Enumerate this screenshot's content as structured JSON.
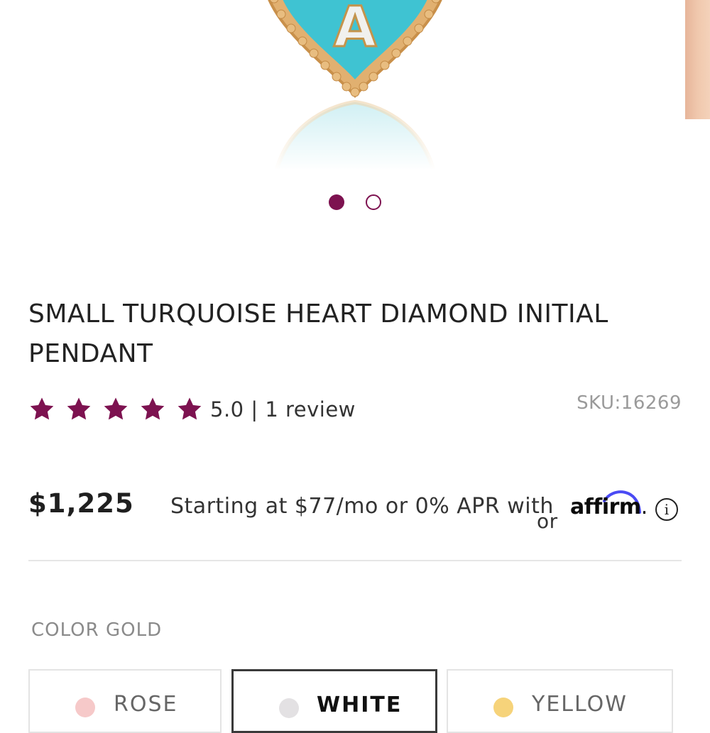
{
  "product": {
    "title_line1": "SMALL TURQUOISE HEART DIAMOND INITIAL",
    "title_line2": "PENDANT",
    "image_letter": "A",
    "rating": 5.0,
    "star_count": 5,
    "rating_text": "5.0 | 1 review",
    "sku": "SKU:16269",
    "price": "$1,225"
  },
  "financing": {
    "text": "Starting at $77/mo or 0% APR with",
    "overflow_text": "or",
    "provider": "affirm",
    "suffix": ".",
    "info_icon": "i"
  },
  "gallery": {
    "slide_count": 2,
    "active_index": 0
  },
  "color": {
    "label": "COLOR GOLD",
    "selected": "WHITE",
    "options": [
      {
        "label": "ROSE",
        "swatch": "#f6c9c9"
      },
      {
        "label": "WHITE",
        "swatch": "#e3e1e3"
      },
      {
        "label": "YELLOW",
        "swatch": "#f6d37a"
      }
    ]
  },
  "colors": {
    "brand": "#7d1250",
    "turquoise": "#3fc3d2",
    "gold": "#d9a65b",
    "affirm_arc": "#4a4af4"
  }
}
